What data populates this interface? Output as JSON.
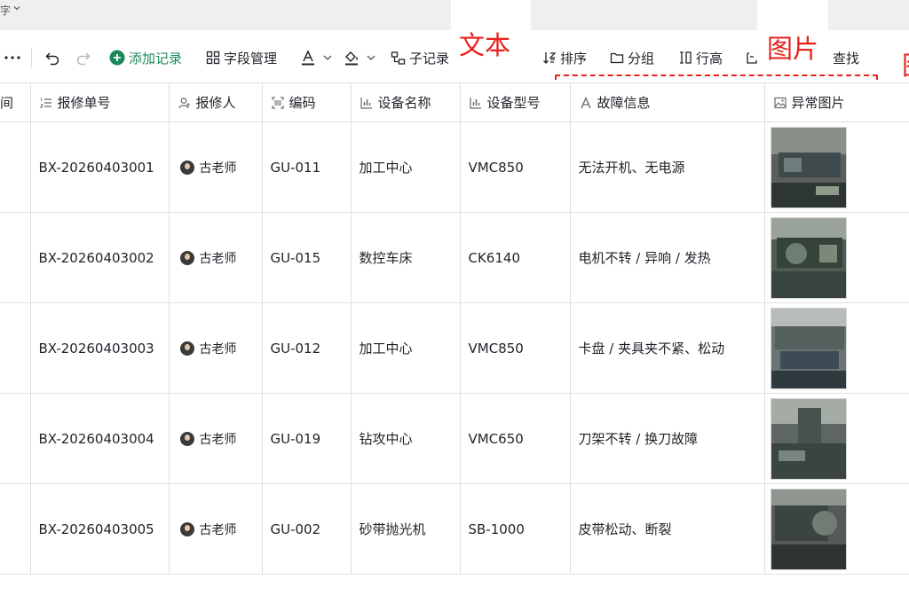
{
  "tab": {
    "title": "字",
    "chevron_icon": "chevron-down-icon"
  },
  "toolbar": {
    "more_icon": "more-icon",
    "undo_icon": "undo-icon",
    "redo_icon": "redo-icon",
    "add_record": "添加记录",
    "field_manage": "字段管理",
    "text_color_icon": "text-color-icon",
    "fill_color_icon": "fill-color-icon",
    "sub_record": "子记录",
    "sort": "排序",
    "group": "分组",
    "row_height": "行高",
    "find": "查找"
  },
  "annotations": {
    "text_label": "文本",
    "image_label": "图片",
    "edge_label": "图",
    "color": "#e5221b"
  },
  "table": {
    "columns": [
      {
        "key": "time",
        "label": "间",
        "icon": "none"
      },
      {
        "key": "order_no",
        "label": "报修单号",
        "icon": "numbered-list-icon"
      },
      {
        "key": "reporter",
        "label": "报修人",
        "icon": "person-icon"
      },
      {
        "key": "code",
        "label": "编码",
        "icon": "scan-code-icon"
      },
      {
        "key": "device_name",
        "label": "设备名称",
        "icon": "chart-icon"
      },
      {
        "key": "device_model",
        "label": "设备型号",
        "icon": "chart-icon"
      },
      {
        "key": "fault",
        "label": "故障信息",
        "icon": "text-a-icon"
      },
      {
        "key": "photo",
        "label": "异常图片",
        "icon": "image-icon"
      }
    ],
    "rows": [
      {
        "order_no": "BX-20260403001",
        "reporter": "古老师",
        "code": "GU-011",
        "device_name": "加工中心",
        "device_model": "VMC850",
        "fault": "无法开机、无电源"
      },
      {
        "order_no": "BX-20260403002",
        "reporter": "古老师",
        "code": "GU-015",
        "device_name": "数控车床",
        "device_model": "CK6140",
        "fault": "电机不转 / 异响 / 发热"
      },
      {
        "order_no": "BX-20260403003",
        "reporter": "古老师",
        "code": "GU-012",
        "device_name": "加工中心",
        "device_model": "VMC850",
        "fault": "卡盘 / 夹具夹不紧、松动"
      },
      {
        "order_no": "BX-20260403004",
        "reporter": "古老师",
        "code": "GU-019",
        "device_name": "钻攻中心",
        "device_model": "VMC650",
        "fault": "刀架不转 / 换刀故障"
      },
      {
        "order_no": "BX-20260403005",
        "reporter": "古老师",
        "code": "GU-002",
        "device_name": "砂带抛光机",
        "device_model": "SB-1000",
        "fault": "皮带松动、断裂"
      }
    ]
  },
  "colors": {
    "accent_green": "#1b8a5a",
    "grid_line": "#dee0e3",
    "annotation_red": "#e5221b"
  }
}
